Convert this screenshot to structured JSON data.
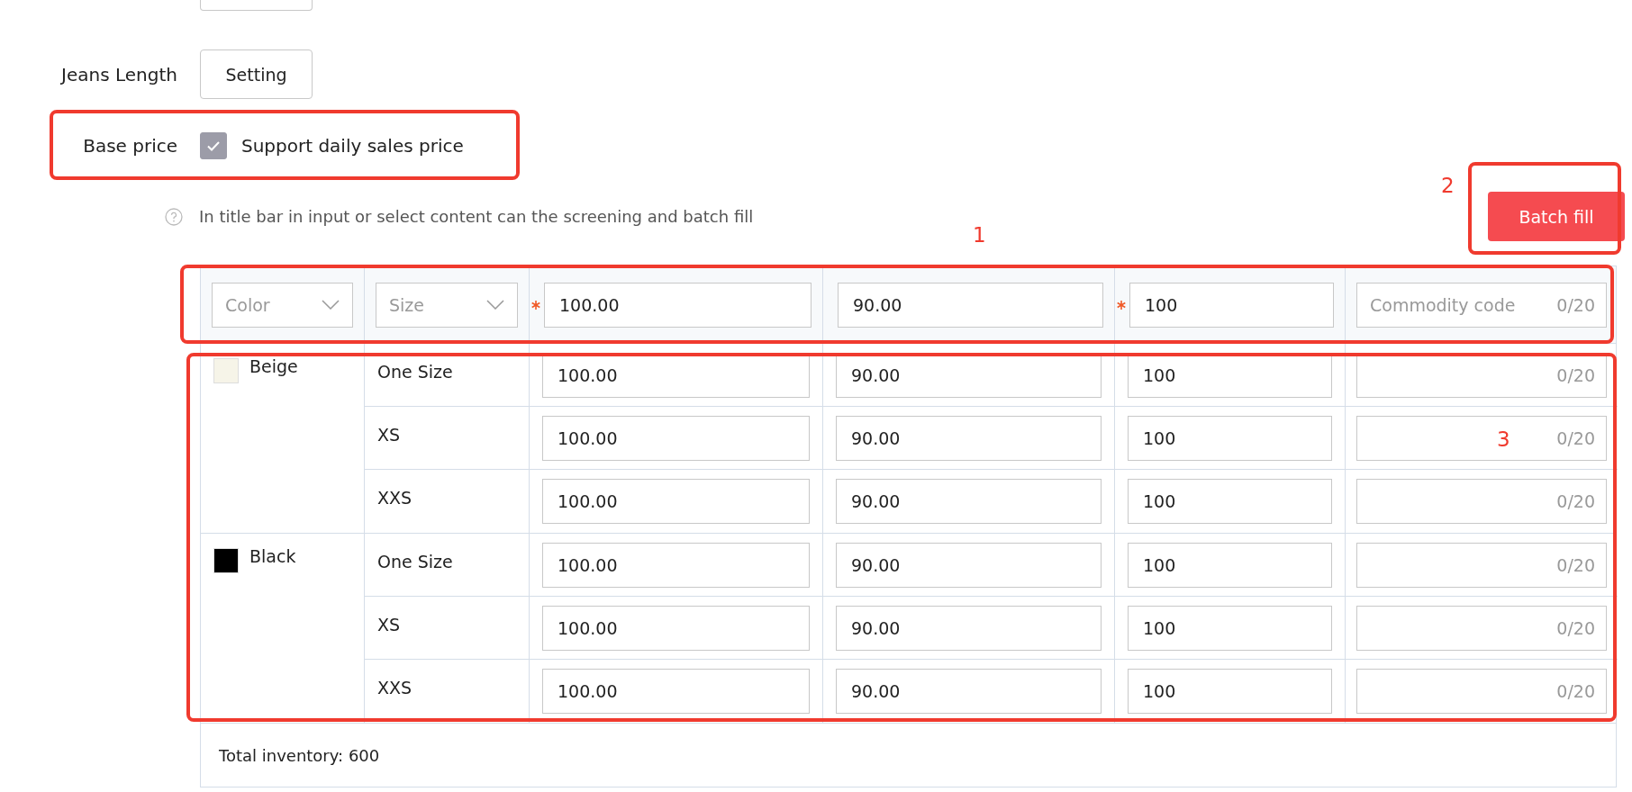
{
  "settings": [
    {
      "label": "Jeans Length",
      "button": "Setting"
    }
  ],
  "base_price": {
    "label": "Base price",
    "checkbox_label": "Support daily sales price",
    "checked": true
  },
  "hint": "In title bar in input or select content can the screening and batch fill",
  "batch_button": "Batch fill",
  "annotations": [
    {
      "label": "1"
    },
    {
      "label": "2"
    },
    {
      "label": "3"
    }
  ],
  "batch_header": {
    "color_placeholder": "Color",
    "size_placeholder": "Size",
    "fields": [
      {
        "value": "100.00",
        "required": true
      },
      {
        "value": "90.00",
        "required": false
      },
      {
        "value": "100",
        "required": true
      }
    ],
    "code": {
      "placeholder": "Commodity code",
      "counter": "0/20"
    }
  },
  "groups": [
    {
      "color_name": "Beige",
      "color": "#f6f4e8",
      "rows": [
        {
          "size": "One Size",
          "price": "100.00",
          "sale_price": "90.00",
          "stock": "100",
          "counter": "0/20"
        },
        {
          "size": "XS",
          "price": "100.00",
          "sale_price": "90.00",
          "stock": "100",
          "counter": "0/20"
        },
        {
          "size": "XXS",
          "price": "100.00",
          "sale_price": "90.00",
          "stock": "100",
          "counter": "0/20"
        }
      ]
    },
    {
      "color_name": "Black",
      "color": "#000000",
      "rows": [
        {
          "size": "One Size",
          "price": "100.00",
          "sale_price": "90.00",
          "stock": "100",
          "counter": "0/20"
        },
        {
          "size": "XS",
          "price": "100.00",
          "sale_price": "90.00",
          "stock": "100",
          "counter": "0/20"
        },
        {
          "size": "XXS",
          "price": "100.00",
          "sale_price": "90.00",
          "stock": "100",
          "counter": "0/20"
        }
      ]
    }
  ],
  "total": "Total inventory: 600"
}
